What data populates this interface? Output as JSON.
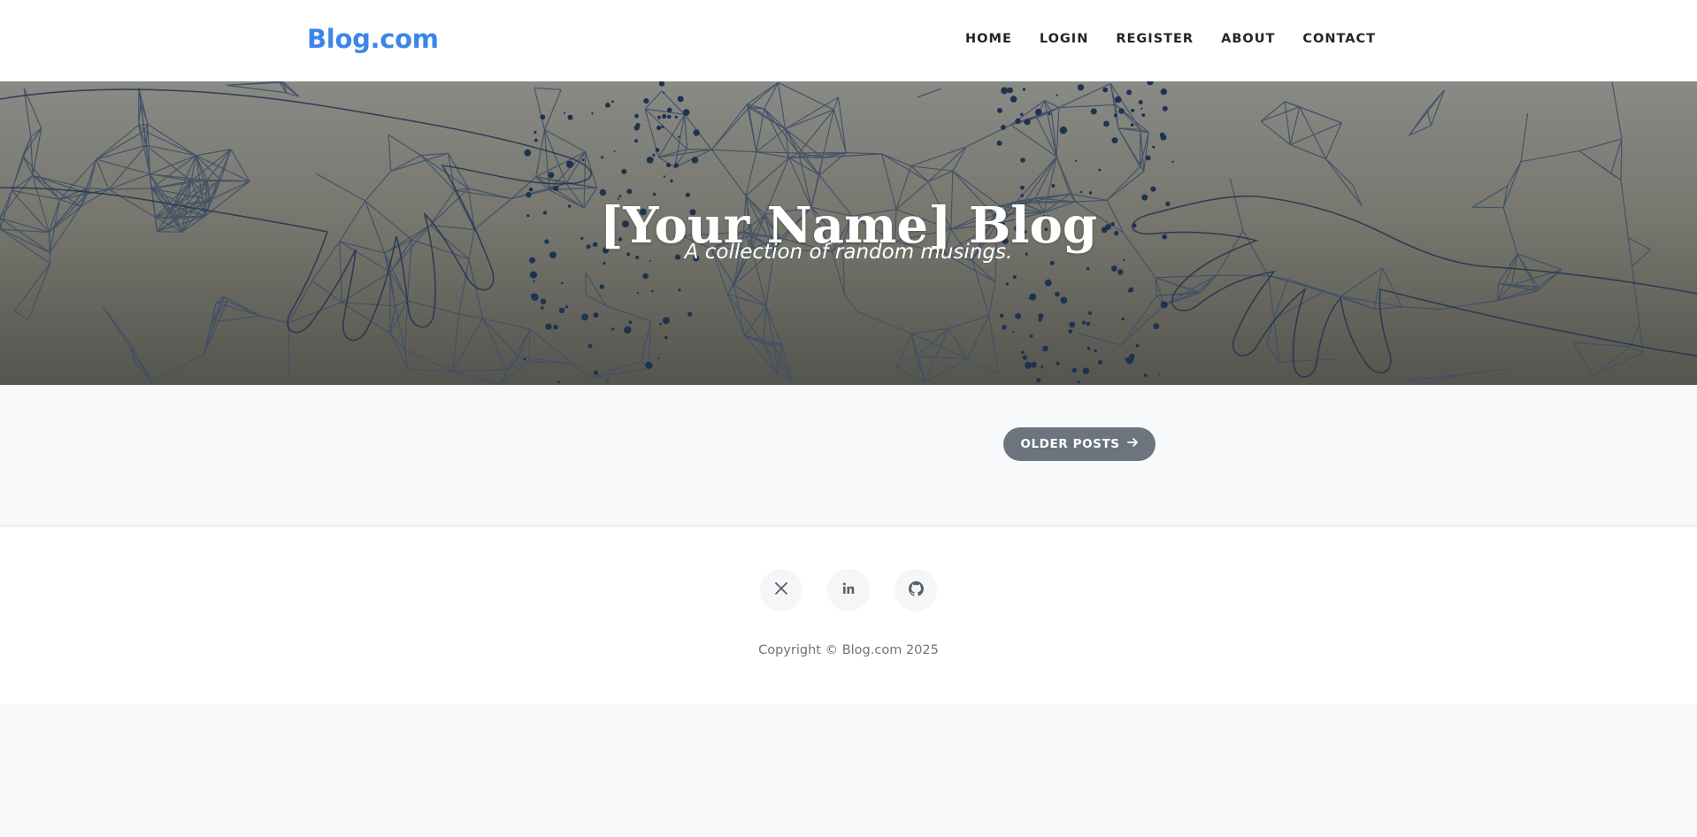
{
  "navbar": {
    "brand": "Blog.com",
    "links": [
      "HOME",
      "LOGIN",
      "REGISTER",
      "ABOUT",
      "CONTACT"
    ]
  },
  "hero": {
    "title": "[Your Name] Blog",
    "subtitle": "A collection of random musings."
  },
  "pager": {
    "older_label": "OLDER POSTS",
    "older_icon": "arrow-right-icon"
  },
  "footer": {
    "social": [
      {
        "name": "x-twitter",
        "icon": "x-icon"
      },
      {
        "name": "linkedin",
        "icon": "linkedin-icon"
      },
      {
        "name": "github",
        "icon": "github-icon"
      }
    ],
    "copyright": "Copyright © Blog.com 2025"
  },
  "colors": {
    "brand": "#3b86e8",
    "button": "#6c757d",
    "text": "#212529",
    "muted": "#6c757d"
  }
}
